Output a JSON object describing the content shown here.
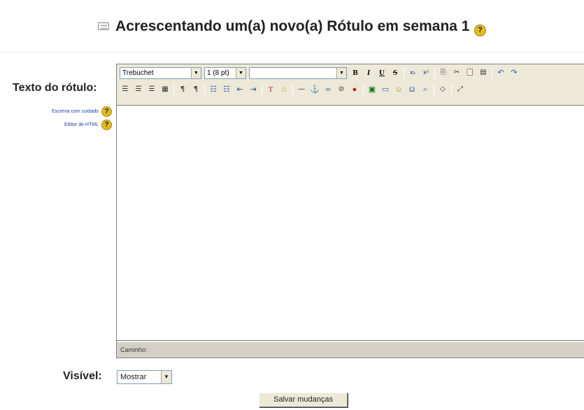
{
  "page": {
    "title": "Acrescentando um(a) novo(a) Rótulo em semana 1",
    "title_icon": "label-icon",
    "help_glyph": "?"
  },
  "form": {
    "label_text_field": "Texto do rótulo:",
    "side_links": [
      {
        "text": "Escreva com cuidado",
        "icon": "help-icon"
      },
      {
        "text": "Editor de HTML",
        "icon": "help-icon"
      }
    ],
    "visible_label": "Visível:",
    "visible_value": "Mostrar",
    "save_button": "Salvar mudanças"
  },
  "editor": {
    "font_family": "Trebuchet",
    "font_size": "1 (8 pt)",
    "paragraph_format": "",
    "dropdown_arrow": "▼",
    "status_path": "Caminho:",
    "colors": {
      "toolbar_bg": "#ece9d8",
      "status_bg": "#d4d0c8",
      "link": "#1b3fb3",
      "help_badge": "#e3bb1f"
    },
    "toolbar_row1": [
      {
        "name": "bold-button",
        "glyph": "B"
      },
      {
        "name": "italic-button",
        "glyph": "I"
      },
      {
        "name": "underline-button",
        "glyph": "U"
      },
      {
        "name": "strikethrough-button",
        "glyph": "S"
      },
      {
        "name": "subscript-button",
        "glyph": "x₂"
      },
      {
        "name": "superscript-button",
        "glyph": "x²"
      },
      {
        "name": "copy-button",
        "glyph": "⎘"
      },
      {
        "name": "cut-button",
        "glyph": "✂"
      },
      {
        "name": "paste-button",
        "glyph": "📋"
      },
      {
        "name": "paste-word-button",
        "glyph": "▤"
      },
      {
        "name": "undo-button",
        "glyph": "↶"
      },
      {
        "name": "redo-button",
        "glyph": "↷"
      }
    ],
    "toolbar_row2": [
      {
        "name": "align-left-button",
        "glyph": "☰"
      },
      {
        "name": "align-center-button",
        "glyph": "☰"
      },
      {
        "name": "align-right-button",
        "glyph": "☰"
      },
      {
        "name": "justify-button",
        "glyph": "▦"
      },
      {
        "name": "ltr-button",
        "glyph": "¶"
      },
      {
        "name": "rtl-button",
        "glyph": "¶"
      },
      {
        "name": "ordered-list-button",
        "glyph": "☷"
      },
      {
        "name": "unordered-list-button",
        "glyph": "☷"
      },
      {
        "name": "outdent-button",
        "glyph": "⇤"
      },
      {
        "name": "indent-button",
        "glyph": "⇥"
      },
      {
        "name": "text-color-button",
        "glyph": "T"
      },
      {
        "name": "bg-color-button",
        "glyph": "⌂"
      },
      {
        "name": "horizontal-rule-button",
        "glyph": "—"
      },
      {
        "name": "anchor-button",
        "glyph": "⚓"
      },
      {
        "name": "link-button",
        "glyph": "∞"
      },
      {
        "name": "unlink-button",
        "glyph": "⊘"
      },
      {
        "name": "no-link-button",
        "glyph": "●"
      },
      {
        "name": "image-button",
        "glyph": "▣"
      },
      {
        "name": "table-button",
        "glyph": "▭"
      },
      {
        "name": "smiley-button",
        "glyph": "☺"
      },
      {
        "name": "special-char-button",
        "glyph": "Ω"
      },
      {
        "name": "search-replace-button",
        "glyph": "⌕"
      },
      {
        "name": "html-source-button",
        "glyph": "◇"
      },
      {
        "name": "fullscreen-button",
        "glyph": "⤢"
      }
    ]
  }
}
